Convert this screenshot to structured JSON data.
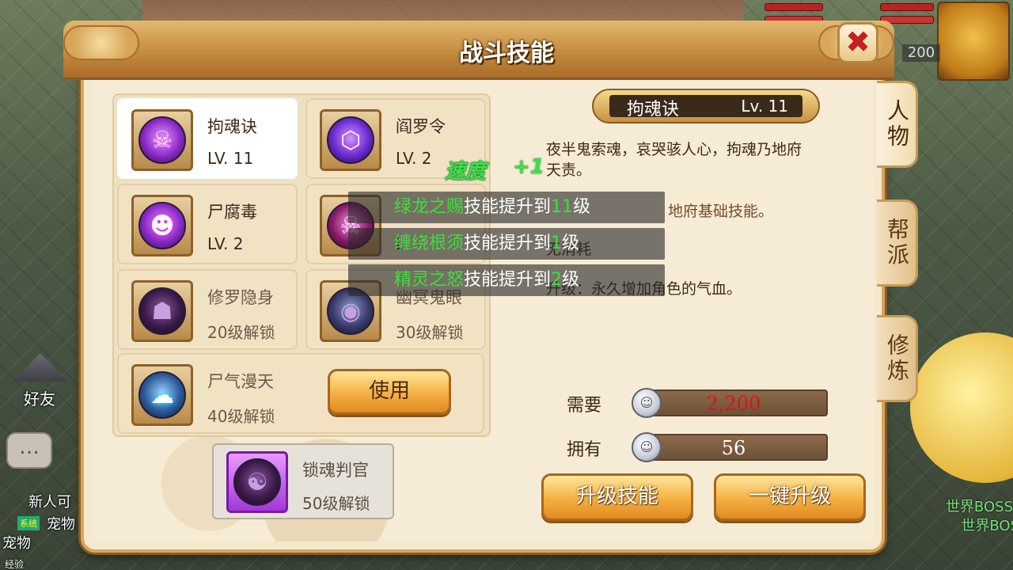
{
  "hud": {
    "level_badge": "200",
    "friends_label": "好友",
    "chat_icon": "…",
    "new_player_text": "新人可",
    "system_tag": "系统",
    "pet_text_1": "宠物",
    "pet_text_2": "宠物",
    "exp_text": "经验",
    "world_boss_1": "世界BOSS",
    "world_boss_2": "世界BOS"
  },
  "dialog": {
    "title": "战斗技能",
    "close_symbol": "✖"
  },
  "side_tabs": [
    {
      "label": "人物",
      "active": true
    },
    {
      "label": "帮派",
      "active": false
    },
    {
      "label": "修炼",
      "active": false
    }
  ],
  "skills": [
    {
      "name": "拘魂诀",
      "sub": "LV. 11",
      "icon": "ghost-skull-icon",
      "glyph": "☠",
      "selected": true
    },
    {
      "name": "阎罗令",
      "sub": "LV. 2",
      "icon": "token-seal-icon",
      "glyph": "⬡"
    },
    {
      "name": "尸腐毒",
      "sub": "LV. 2",
      "icon": "poison-ghost-icon",
      "glyph": "☻"
    },
    {
      "name": "",
      "sub": "L",
      "icon": "skull-icon",
      "glyph": "☠"
    },
    {
      "name": "修罗隐身",
      "sub": "20级解锁",
      "icon": "shadow-stealth-icon",
      "glyph": "☗",
      "locked": true
    },
    {
      "name": "幽冥鬼眼",
      "sub": "30级解锁",
      "icon": "ghost-eye-icon",
      "glyph": "◉",
      "locked": true
    },
    {
      "name": "尸气漫天",
      "sub": "40级解锁",
      "icon": "corpse-mist-icon",
      "glyph": "☁",
      "locked": true
    }
  ],
  "use_button": "使用",
  "bonus_skill": {
    "name": "锁魂判官",
    "sub": "50级解锁",
    "icon": "yin-yang-icon",
    "glyph": "☯"
  },
  "detail": {
    "name": "拘魂诀",
    "level": "Lv. 11",
    "desc_line1": "夜半鬼索魂，哀哭骇人心，拘魂乃地府",
    "desc_line2": "天责。",
    "type_text": "地府基础技能。",
    "cost_text": "无消耗",
    "upgrade_text": "升级：永久增加角色的气血。"
  },
  "float_text": {
    "stat": "速度",
    "bonus": "+1"
  },
  "toasts": [
    {
      "skill": "绿龙之赐",
      "mid": "技能提升到",
      "num": "11",
      "tail": "级"
    },
    {
      "skill": "缠绕根须",
      "mid": "技能提升到",
      "num": "1",
      "tail": "级"
    },
    {
      "skill": "精灵之怒",
      "mid": "技能提升到",
      "num": "2",
      "tail": "级"
    }
  ],
  "cost": {
    "need_label": "需要",
    "need_value": "2,200",
    "need_color": "#e01010",
    "have_label": "拥有",
    "have_value": "56",
    "have_color": "#ffffff",
    "coin_icon": "silver-coin-icon"
  },
  "buttons": {
    "upgrade": "升级技能",
    "one_click": "一键升级"
  }
}
